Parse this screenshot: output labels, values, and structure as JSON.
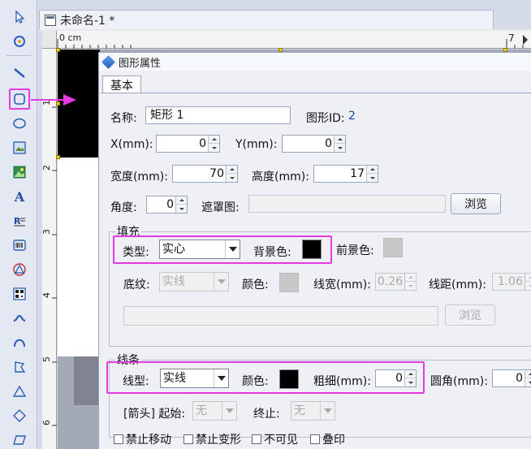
{
  "document": {
    "tab_title": "未命名-1 *"
  },
  "ruler": {
    "unit": "0 cm",
    "top_marks": [
      "7"
    ],
    "left_marks": [
      "1",
      "2",
      "3",
      "4",
      "5",
      "6"
    ]
  },
  "dialog": {
    "title": "图形属性",
    "tab_basic": "基本",
    "name_label": "名称:",
    "name_value": "矩形 1",
    "id_label": "图形ID:",
    "id_value": "2",
    "x_label": "X(mm):",
    "x_value": "0",
    "y_label": "Y(mm):",
    "y_value": "0",
    "width_label": "宽度(mm):",
    "width_value": "70",
    "height_label": "高度(mm):",
    "height_value": "17",
    "angle_label": "角度:",
    "angle_value": "0",
    "mask_label": "遮罩图:",
    "mask_value": "",
    "browse_label": "浏览",
    "fill": {
      "group_title": "填充",
      "type_label": "类型:",
      "type_value": "实心",
      "bg_label": "背景色:",
      "bg_color": "#000000",
      "fg_label": "前景色:",
      "fg_color": "#c8c8c8",
      "pattern_label": "底纹:",
      "pattern_value": "实线",
      "color_label": "颜色:",
      "color_value": "#c8c8c8",
      "line_width_label": "线宽(mm):",
      "line_width_value": "0.26",
      "line_spacing_label": "线距(mm):",
      "line_spacing_value": "1.06",
      "browse_label": "浏览"
    },
    "line": {
      "group_title": "线条",
      "type_label": "线型:",
      "type_value": "实线",
      "color_label": "颜色:",
      "color_value": "#000000",
      "thickness_label": "粗细(mm):",
      "thickness_value": "0",
      "corner_label": "圆角(mm):",
      "corner_value": "0",
      "arrow_label": "[箭头] 起始:",
      "arrow_start_value": "无",
      "arrow_end_label": "终止:",
      "arrow_end_value": "无"
    },
    "checkboxes": {
      "no_move": "禁止移动",
      "no_transform": "禁止变形",
      "invisible": "不可见",
      "overprint": "叠印"
    }
  },
  "colors": {
    "highlight": "#e33be0",
    "accent": "#2a5fb5"
  }
}
